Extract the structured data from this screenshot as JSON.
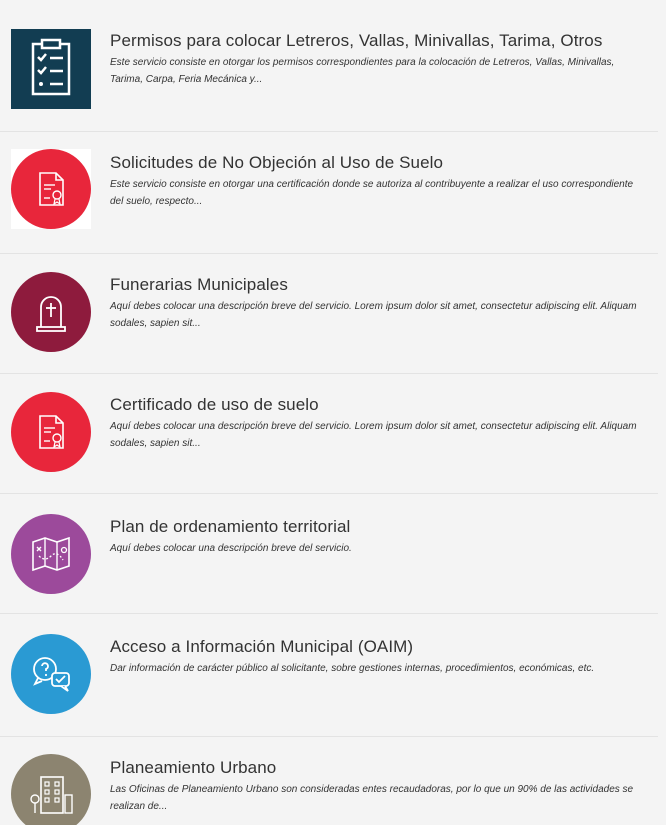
{
  "services": [
    {
      "title": "Permisos para colocar Letreros, Vallas, Minivallas, Tarima, Otros",
      "description": "Este servicio consiste en otorgar los permisos correspondientes para la colocación de Letreros, Vallas, Minivallas, Tarima, Carpa, Feria Mecánica y...",
      "icon": "clipboard-checklist-icon",
      "color": "#123d52"
    },
    {
      "title": "Solicitudes de No Objeción al Uso de Suelo",
      "description": "Este servicio consiste en otorgar una certificación donde se autoriza al contribuyente a realizar el uso correspondiente del suelo, respecto...",
      "icon": "certificate-document-icon",
      "color": "#e8263b"
    },
    {
      "title": "Funerarias Municipales",
      "description": "Aquí debes colocar una descripción breve del servicio. Lorem ipsum dolor sit amet, consectetur adipiscing elit. Aliquam sodales, sapien sit...",
      "icon": "tombstone-icon",
      "color": "#8e1b3d"
    },
    {
      "title": "Certificado de uso de suelo",
      "description": "Aquí debes colocar una descripción breve del servicio. Lorem ipsum dolor sit amet, consectetur adipiscing elit. Aliquam sodales, sapien sit...",
      "icon": "certificate-document-icon",
      "color": "#e8263b"
    },
    {
      "title": "Plan de ordenamiento territorial",
      "description": "Aquí debes colocar una descripción breve del servicio.",
      "icon": "map-route-icon",
      "color": "#9c4a9b"
    },
    {
      "title": "Acceso a Información Municipal (OAIM)",
      "description": "Dar información de carácter público al solicitante, sobre gestiones internas, procedimientos, económicas, etc.",
      "icon": "question-chat-icon",
      "color": "#2a9ad3"
    },
    {
      "title": "Planeamiento Urbano",
      "description": "Las Oficinas de Planeamiento Urbano son consideradas entes recaudadoras, por lo que un 90% de las actividades se realizan de...",
      "icon": "building-icon",
      "color": "#8c8470"
    }
  ]
}
